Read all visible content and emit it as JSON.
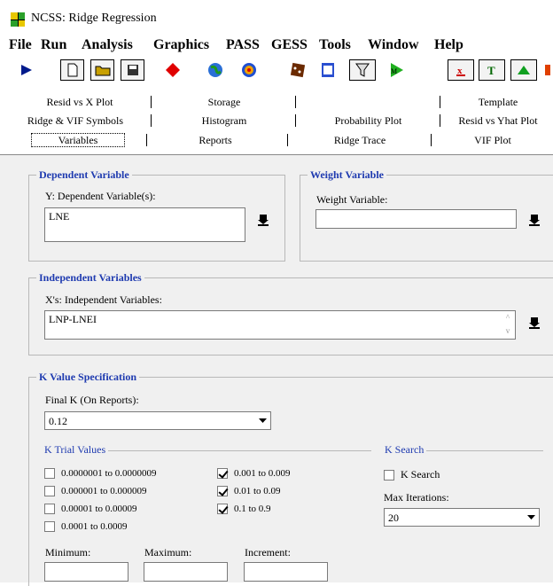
{
  "window": {
    "title": "NCSS: Ridge Regression"
  },
  "menu": [
    "File",
    "Run",
    "Analysis",
    "Graphics",
    "PASS",
    "GESS",
    "Tools",
    "Window",
    "Help"
  ],
  "tabs": {
    "row1": [
      "Resid vs X Plot",
      "Storage",
      "",
      "Template"
    ],
    "row2": [
      "Ridge & VIF Symbols",
      "Histogram",
      "Probability Plot",
      "Resid vs Yhat Plot"
    ],
    "row3": [
      "Variables",
      "Reports",
      "Ridge Trace",
      "VIF Plot"
    ]
  },
  "dependent": {
    "legend": "Dependent Variable",
    "label": "Y: Dependent Variable(s):",
    "value": "LNE"
  },
  "weight": {
    "legend": "Weight Variable",
    "label": "Weight Variable:",
    "value": ""
  },
  "independent": {
    "legend": "Independent Variables",
    "label": "X's: Independent Variables:",
    "value": "LNP-LNEI"
  },
  "kspec": {
    "legend": "K Value Specification",
    "final_k_label": "Final K (On Reports):",
    "final_k_value": "0.12",
    "trial_legend": "K Trial Values",
    "trials": [
      {
        "label": "0.0000001 to 0.0000009",
        "checked": false
      },
      {
        "label": "0.000001 to 0.000009",
        "checked": false
      },
      {
        "label": "0.00001 to 0.00009",
        "checked": false
      },
      {
        "label": "0.0001 to 0.0009",
        "checked": false
      },
      {
        "label": "0.001 to 0.009",
        "checked": true
      },
      {
        "label": "0.01 to 0.09",
        "checked": true
      },
      {
        "label": "0.1 to 0.9",
        "checked": true
      }
    ],
    "min_label": "Minimum:",
    "max_label": "Maximum:",
    "inc_label": "Increment:",
    "search_legend": "K Search",
    "search_label": "K Search",
    "search_checked": false,
    "max_iter_label": "Max Iterations:",
    "max_iter_value": "20"
  },
  "toolbar_icons": [
    "run-icon",
    "new-icon",
    "open-icon",
    "save-icon",
    "stop-icon",
    "globe-icon",
    "target-icon",
    "dice-icon",
    "notepad-icon",
    "filter-icon",
    "macro-icon",
    "delete-icon",
    "t-icon",
    "up-icon"
  ]
}
